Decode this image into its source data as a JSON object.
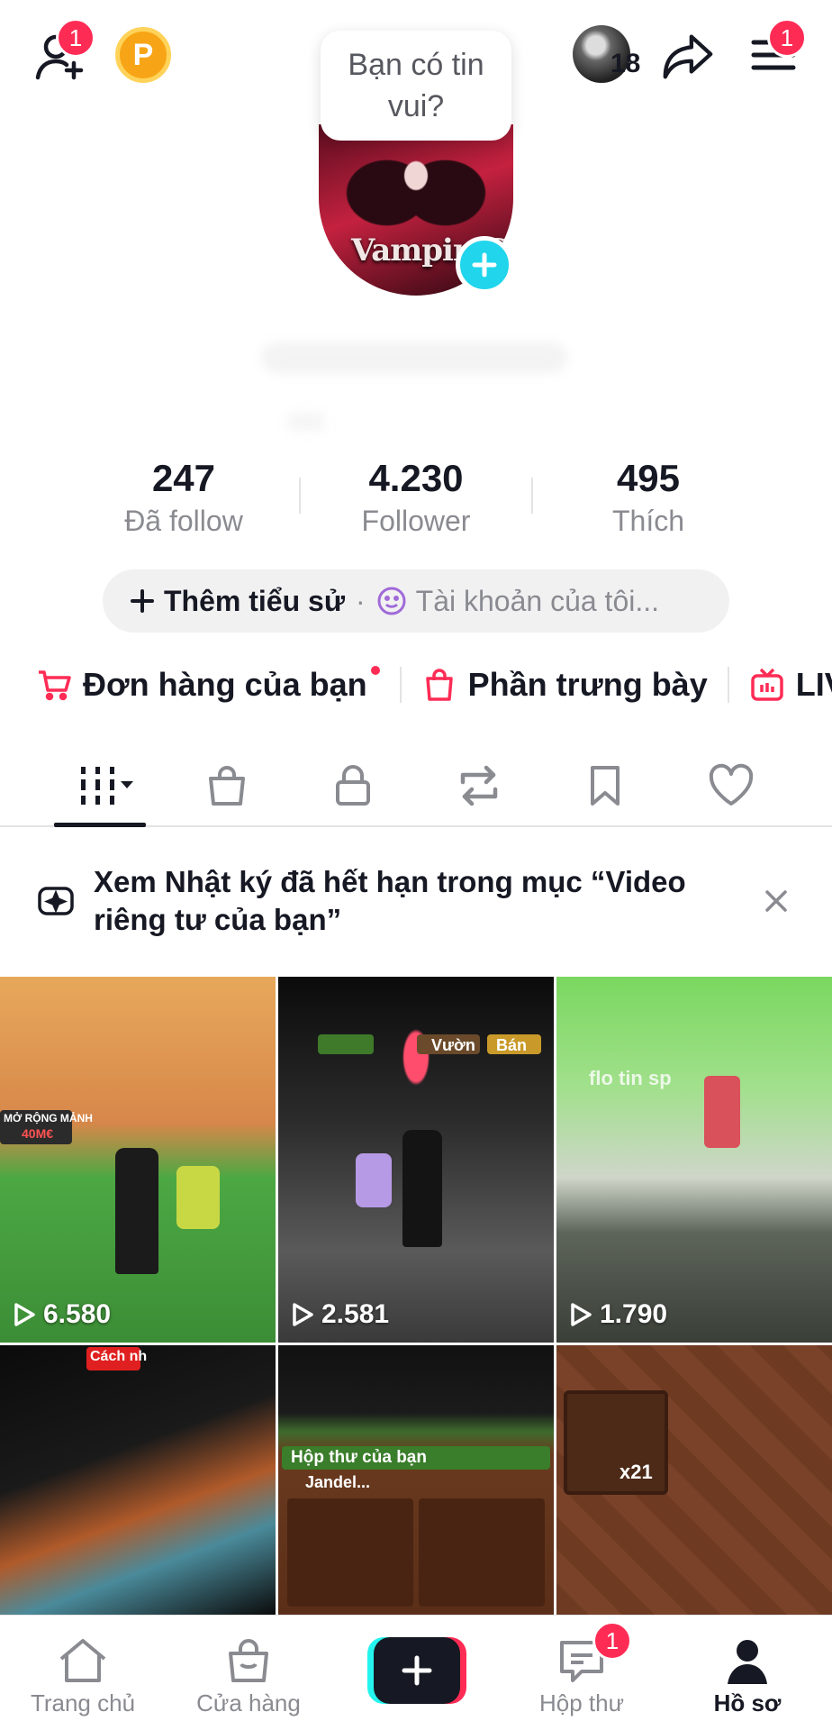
{
  "header": {
    "add_friend_badge": "1",
    "coin_label": "P",
    "mini_avatar_count": "18",
    "menu_badge": "1",
    "bubble_text": "Bạn có tin vui?"
  },
  "profile": {
    "avatar_text": "VampireS"
  },
  "stats": [
    {
      "value": "247",
      "label": "Đã follow"
    },
    {
      "value": "4.230",
      "label": "Follower"
    },
    {
      "value": "495",
      "label": "Thích"
    }
  ],
  "bio": {
    "add_label": "Thêm tiểu sử",
    "separator": "·",
    "account_label": "Tài khoản của tôi..."
  },
  "shortcuts": [
    {
      "label": "Đơn hàng của bạn",
      "icon": "cart-icon"
    },
    {
      "label": "Phần trưng bày",
      "icon": "bag-icon"
    },
    {
      "label": "LIV",
      "icon": "live-tv-icon"
    }
  ],
  "tabs": [
    {
      "name": "videos-grid-icon",
      "active": true
    },
    {
      "name": "shop-bag-icon"
    },
    {
      "name": "lock-icon"
    },
    {
      "name": "repost-icon"
    },
    {
      "name": "bookmark-icon"
    },
    {
      "name": "heart-icon"
    }
  ],
  "banner": {
    "text": "Xem Nhật ký đã hết hạn trong mục “Video riêng tư của bạn”"
  },
  "videos": [
    {
      "views": "6.580",
      "label_1": "MỞ RỘNG MẢNH",
      "label_2": "40M€"
    },
    {
      "views": "2.581",
      "label_1": "Vườn",
      "label_2": "Bán"
    },
    {
      "views": "1.790",
      "label_1": "flo tin sp"
    },
    {
      "label_1": "Cách nh"
    },
    {
      "label_1": "Hộp thư của bạn",
      "label_2": "Jandel..."
    },
    {
      "label_1": "x21"
    }
  ],
  "nav": {
    "home": "Trang chủ",
    "shop": "Cửa hàng",
    "inbox": "Hộp thư",
    "inbox_badge": "1",
    "profile": "Hồ sơ"
  },
  "colors": {
    "accent": "#fe2c55",
    "cyan": "#25f4ee",
    "avatar_plus": "#20d5ec",
    "coin": "#f7a516"
  }
}
